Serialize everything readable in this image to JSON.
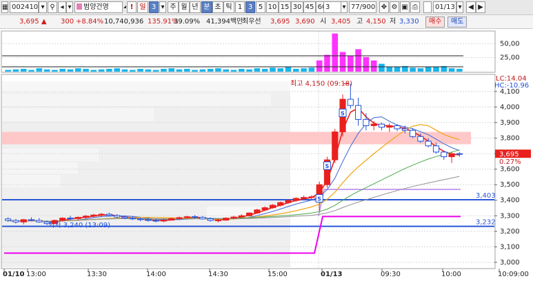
{
  "toolbar": {
    "code": "002410",
    "name": "범양건영",
    "excl": "!",
    "period_day": "일",
    "period_num": "3",
    "week": "주",
    "month": "월",
    "year": "년",
    "minute": "분",
    "second": "초",
    "tick": "틱",
    "intervals": [
      "1",
      "3",
      "5",
      "10",
      "15",
      "30",
      "45",
      "60"
    ],
    "count_value": "3",
    "page_count": "77/900",
    "date": "01/13"
  },
  "quote": {
    "price": "3,695",
    "change": "300",
    "change_pct": "+8.84%",
    "volume": "10,740,936",
    "volume_ratio": "135.91%",
    "turnover": "39.09%",
    "amount": "41,394백만",
    "best_label": "최우선",
    "ask": "3,695",
    "bid": "3,690",
    "open_label": "시",
    "open": "3,405",
    "high_label": "고",
    "high": "4,150",
    "low_label": "저",
    "low": "3,330",
    "buy_label": "매수",
    "sell_label": "매도"
  },
  "volume_axis": [
    "50,00",
    "25,00"
  ],
  "price_axis": [
    "4,100",
    "4,000",
    "3,900",
    "3,800",
    "3,700",
    "3,600",
    "3,500",
    "3,400",
    "3,300",
    "3,200",
    "3,100",
    "3,000"
  ],
  "indicators": {
    "lc": "LC:14.04",
    "hc": "HC:-10.96",
    "current_price": "3,695",
    "current_pct": "0.27%",
    "level_high": "3,403",
    "level_low": "3,232",
    "high_annotation": "최고 4,150 (09:18)",
    "low_annotation": "최저 3,240 (13:09)"
  },
  "time_axis": [
    "01/10",
    "13:00",
    "13:30",
    "14:00",
    "14:30",
    "15:00",
    "01/13",
    "09:30",
    "10:00",
    "10:09:00"
  ],
  "colors": {
    "up": "#e8211e",
    "down": "#2050d8",
    "volume": "#18b4ec",
    "volume_high": "#ff33ff",
    "ma5": "#e8211e",
    "ma10": "#4a6fd8",
    "ma20": "#f0a818",
    "ma60": "#4aa84a",
    "ma120": "#909090",
    "level_line": "#2a56d8",
    "magenta": "#ee00ee",
    "band": "#ffc8c8"
  },
  "chart_data": {
    "type": "candlestick",
    "y_unit": "KRW",
    "ylim": [
      2960,
      4210
    ],
    "x_categories": [
      "01/10 13:00",
      "13:30",
      "14:00",
      "14:30",
      "15:00",
      "01/13 09:00",
      "09:30",
      "10:00"
    ],
    "candles": [
      [
        3280,
        3290,
        3260,
        3270
      ],
      [
        3270,
        3280,
        3250,
        3260
      ],
      [
        3260,
        3280,
        3245,
        3275
      ],
      [
        3275,
        3290,
        3265,
        3270
      ],
      [
        3270,
        3285,
        3255,
        3260
      ],
      [
        3260,
        3270,
        3240,
        3250
      ],
      [
        3250,
        3275,
        3245,
        3270
      ],
      [
        3270,
        3290,
        3262,
        3285
      ],
      [
        3285,
        3300,
        3272,
        3282
      ],
      [
        3282,
        3295,
        3270,
        3290
      ],
      [
        3290,
        3305,
        3280,
        3298
      ],
      [
        3298,
        3312,
        3288,
        3305
      ],
      [
        3305,
        3318,
        3295,
        3310
      ],
      [
        3310,
        3320,
        3296,
        3302
      ],
      [
        3302,
        3310,
        3285,
        3292
      ],
      [
        3292,
        3300,
        3278,
        3285
      ],
      [
        3285,
        3296,
        3272,
        3280
      ],
      [
        3280,
        3290,
        3265,
        3275
      ],
      [
        3275,
        3286,
        3262,
        3270
      ],
      [
        3270,
        3282,
        3258,
        3266
      ],
      [
        3266,
        3280,
        3258,
        3272
      ],
      [
        3272,
        3288,
        3268,
        3282
      ],
      [
        3282,
        3295,
        3275,
        3288
      ],
      [
        3288,
        3300,
        3280,
        3294
      ],
      [
        3294,
        3305,
        3282,
        3290
      ],
      [
        3290,
        3298,
        3275,
        3280
      ],
      [
        3280,
        3288,
        3262,
        3270
      ],
      [
        3270,
        3282,
        3258,
        3272
      ],
      [
        3272,
        3290,
        3268,
        3285
      ],
      [
        3285,
        3300,
        3278,
        3292
      ],
      [
        3292,
        3310,
        3285,
        3300
      ],
      [
        3300,
        3322,
        3295,
        3318
      ],
      [
        3318,
        3345,
        3312,
        3338
      ],
      [
        3338,
        3360,
        3330,
        3352
      ],
      [
        3352,
        3375,
        3345,
        3368
      ],
      [
        3368,
        3392,
        3360,
        3385
      ],
      [
        3385,
        3405,
        3378,
        3398
      ],
      [
        3398,
        3420,
        3390,
        3412
      ],
      [
        3412,
        3430,
        3400,
        3418
      ],
      [
        3418,
        3432,
        3405,
        3422
      ],
      [
        3405,
        3520,
        3330,
        3500
      ],
      [
        3500,
        3680,
        3480,
        3660
      ],
      [
        3660,
        3860,
        3640,
        3840
      ],
      [
        3840,
        4080,
        3810,
        4050
      ],
      [
        4050,
        4150,
        3990,
        4010
      ],
      [
        4010,
        4060,
        3880,
        3920
      ],
      [
        3920,
        3960,
        3850,
        3880
      ],
      [
        3880,
        3910,
        3850,
        3890
      ],
      [
        3890,
        3900,
        3850,
        3870
      ],
      [
        3870,
        3895,
        3840,
        3880
      ],
      [
        3880,
        3890,
        3845,
        3860
      ],
      [
        3860,
        3880,
        3830,
        3850
      ],
      [
        3850,
        3865,
        3800,
        3810
      ],
      [
        3810,
        3830,
        3770,
        3780
      ],
      [
        3780,
        3800,
        3740,
        3750
      ],
      [
        3750,
        3770,
        3700,
        3710
      ],
      [
        3710,
        3720,
        3660,
        3680
      ],
      [
        3680,
        3710,
        3640,
        3700
      ],
      [
        3700,
        3710,
        3680,
        3695
      ]
    ],
    "volumes": [
      3,
      4,
      5,
      3,
      6,
      4,
      3,
      5,
      4,
      6,
      5,
      3,
      4,
      5,
      6,
      4,
      3,
      5,
      4,
      3,
      5,
      6,
      4,
      5,
      3,
      4,
      5,
      6,
      4,
      3,
      5,
      4,
      6,
      5,
      7,
      6,
      8,
      5,
      6,
      7,
      20,
      30,
      68,
      35,
      28,
      40,
      26,
      20,
      14,
      9,
      8,
      10,
      7,
      6,
      9,
      8,
      10,
      6,
      5
    ]
  }
}
